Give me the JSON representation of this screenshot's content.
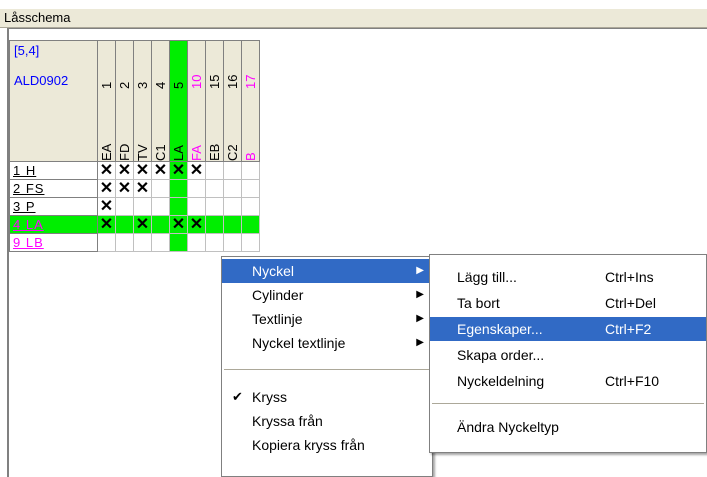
{
  "window": {
    "title": "Låsschema"
  },
  "grid": {
    "corner_coord": "[5,4]",
    "corner_code": "ALD0902",
    "columns": [
      {
        "num": "1",
        "label": "EA",
        "selected": false,
        "magenta": false
      },
      {
        "num": "2",
        "label": "FD",
        "selected": false,
        "magenta": false
      },
      {
        "num": "3",
        "label": "TV",
        "selected": false,
        "magenta": false
      },
      {
        "num": "4",
        "label": "C1",
        "selected": false,
        "magenta": false
      },
      {
        "num": "5",
        "label": "LA",
        "selected": true,
        "magenta": false
      },
      {
        "num": "10",
        "label": "FA",
        "selected": false,
        "magenta": true
      },
      {
        "num": "15",
        "label": "EB",
        "selected": false,
        "magenta": false
      },
      {
        "num": "16",
        "label": "C2",
        "selected": false,
        "magenta": false
      },
      {
        "num": "17",
        "label": "B",
        "selected": false,
        "magenta": true
      }
    ],
    "rows": [
      {
        "label": "1 H",
        "selected": false,
        "magenta": false,
        "cells": [
          "X",
          "X",
          "X",
          "X",
          "X",
          "X",
          "",
          "",
          ""
        ]
      },
      {
        "label": "2 FS",
        "selected": false,
        "magenta": false,
        "cells": [
          "X",
          "X",
          "X",
          "",
          "",
          "",
          "",
          "",
          ""
        ]
      },
      {
        "label": "3 P",
        "selected": false,
        "magenta": false,
        "cells": [
          "X",
          "",
          "",
          "",
          "",
          "",
          "",
          "",
          ""
        ]
      },
      {
        "label": "4 LA",
        "selected": true,
        "magenta": false,
        "cells": [
          "X",
          "",
          "X",
          "",
          "X",
          "X",
          "",
          "",
          ""
        ]
      },
      {
        "label": "9 LB",
        "selected": false,
        "magenta": true,
        "cells": [
          "",
          "",
          "",
          "",
          "",
          "",
          "",
          "",
          ""
        ]
      }
    ],
    "cross_symbol": "✕"
  },
  "context_menu": {
    "items": [
      {
        "label": "Nyckel",
        "has_submenu": true,
        "highlighted": true
      },
      {
        "label": "Cylinder",
        "has_submenu": true
      },
      {
        "label": "Textlinje",
        "has_submenu": true
      },
      {
        "label": "Nyckel textlinje",
        "has_submenu": true
      },
      {
        "label": "Kryss",
        "checked": true
      },
      {
        "label": "Kryssa från"
      },
      {
        "label": "Kopiera kryss från"
      }
    ],
    "submenu_arrow": "▶",
    "check_mark": "✔"
  },
  "submenu": {
    "items": [
      {
        "label": "Lägg till...",
        "shortcut": "Ctrl+Ins"
      },
      {
        "label": "Ta bort",
        "shortcut": "Ctrl+Del"
      },
      {
        "label": "Egenskaper...",
        "shortcut": "Ctrl+F2",
        "highlighted": true
      },
      {
        "label": "Skapa order...",
        "shortcut": ""
      },
      {
        "label": "Nyckeldelning",
        "shortcut": "Ctrl+F10"
      },
      {
        "label": "Ändra Nyckeltyp",
        "shortcut": ""
      }
    ]
  },
  "colors": {
    "selection_green": "#00ee00",
    "menu_highlight": "#316ac5",
    "magenta": "#ff00ff",
    "blue_text": "#0000ff"
  }
}
